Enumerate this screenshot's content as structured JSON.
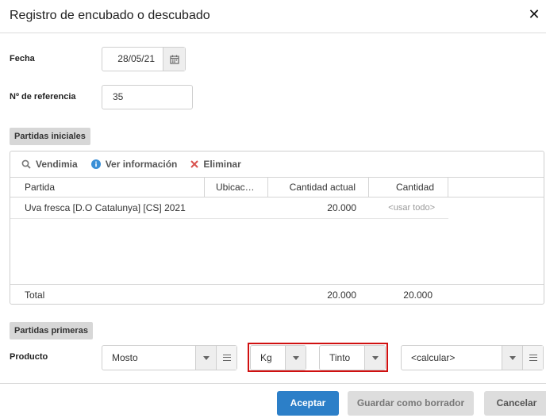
{
  "dialog": {
    "title": "Registro de encubado o descubado",
    "close_label": "✕"
  },
  "fields": {
    "fecha_label": "Fecha",
    "fecha_value": "28/05/21",
    "referencia_label": "Nº de referencia",
    "referencia_value": "35"
  },
  "partidas_iniciales": {
    "section_label": "Partidas iniciales",
    "toolbar": {
      "vendimia": "Vendimia",
      "ver_informacion": "Ver información",
      "eliminar": "Eliminar"
    },
    "columns": [
      "Partida",
      "Ubicac…",
      "Cantidad actual",
      "Cantidad"
    ],
    "rows": [
      {
        "partida": "Uva fresca [D.O Catalunya] [CS] 2021",
        "ubicacion": "",
        "cantidad_actual": "20.000",
        "cantidad": "<usar todo>"
      }
    ],
    "total": {
      "label": "Total",
      "cantidad_actual": "20.000",
      "cantidad": "20.000"
    }
  },
  "partidas_primeras": {
    "section_label": "Partidas primeras",
    "producto_label": "Producto",
    "producto_value": "Mosto",
    "unidad_value": "Kg",
    "tipo_value": "Tinto",
    "calcular_placeholder": "<calcular>"
  },
  "footer": {
    "aceptar": "Aceptar",
    "guardar_borrador": "Guardar como borrador",
    "cancelar": "Cancelar"
  },
  "colors": {
    "primary": "#2c7fc8",
    "highlight": "#d01010",
    "info": "#3a8fd6",
    "delete": "#d9534f"
  },
  "icons": [
    "close-icon",
    "calendar-icon",
    "search-icon",
    "info-icon",
    "delete-icon",
    "chevron-down-icon",
    "menu-icon"
  ]
}
